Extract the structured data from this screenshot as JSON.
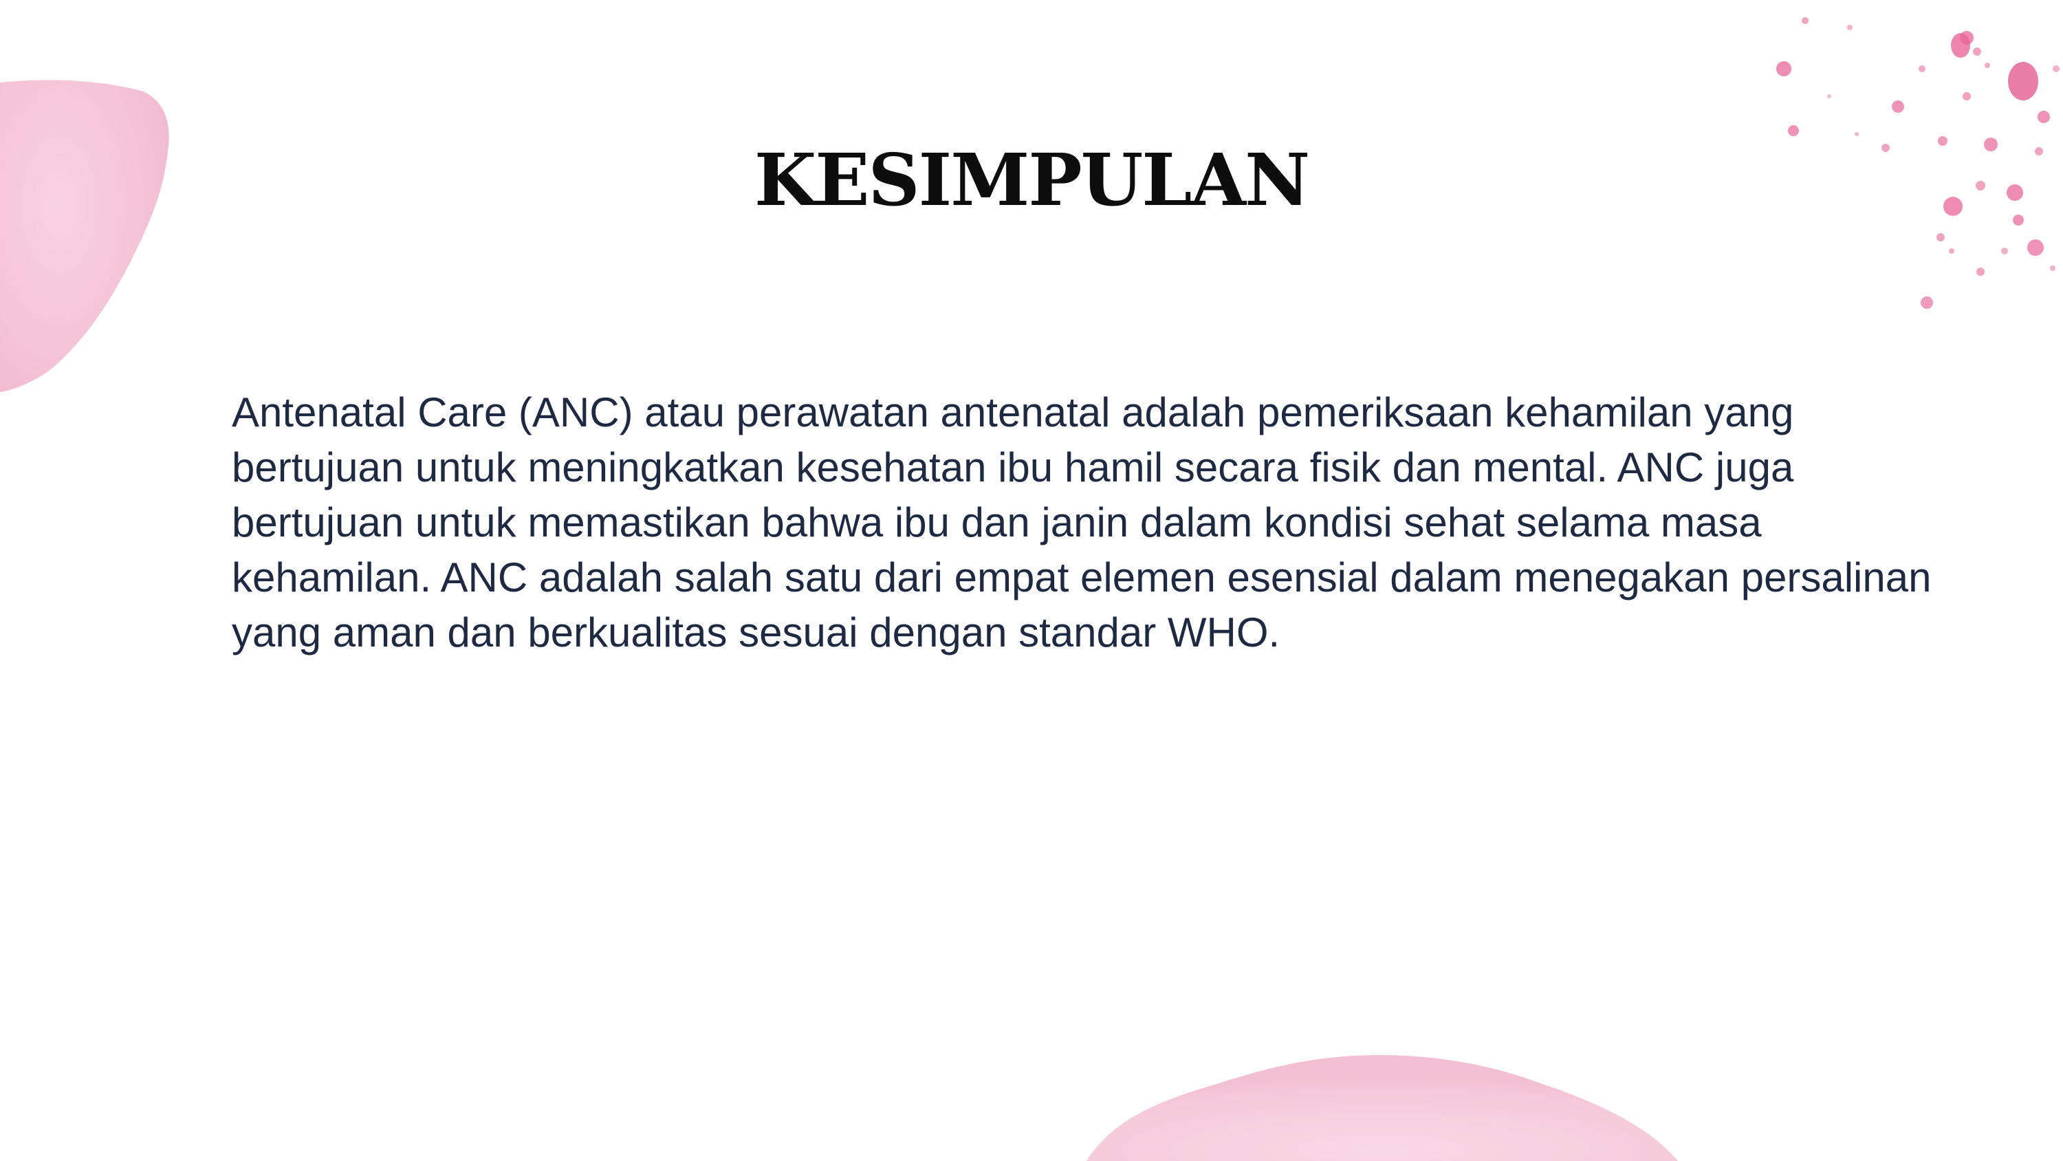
{
  "slide": {
    "title": "KESIMPULAN",
    "body": "Antenatal Care (ANC) atau perawatan antenatal adalah pemeriksaan kehamilan yang bertujuan untuk meningkatkan kesehatan ibu hamil secara fisik dan mental. ANC juga bertujuan untuk memastikan bahwa ibu dan janin dalam kondisi sehat selama masa kehamilan. ANC adalah salah satu dari empat elemen esensial dalam menegakan persalinan yang aman dan berkualitas sesuai dengan standar WHO."
  },
  "colors": {
    "background": "#ffffff",
    "title": "#0d0d0d",
    "body_text": "#1e2a44",
    "accent_pink": "#f2b8cf",
    "splatter_pink": "#e8669a"
  },
  "decorations": [
    "pink-watercolor-blob-left",
    "pink-paint-splatter-top-right",
    "pink-watercolor-blob-bottom"
  ]
}
